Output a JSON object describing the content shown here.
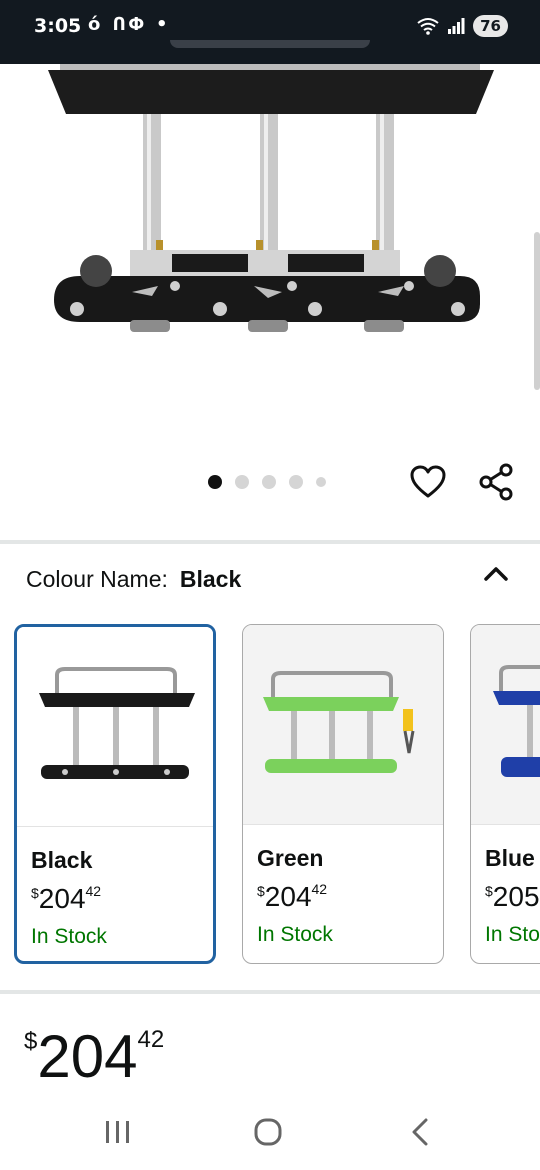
{
  "status_bar": {
    "time": "3:05",
    "left_icons": "ό ՈՓ •",
    "battery": "76"
  },
  "carousel": {
    "total_images": 5,
    "active_index": 0
  },
  "colour": {
    "label": "Colour Name:",
    "value": "Black"
  },
  "swatches": [
    {
      "name": "Black",
      "price_symbol": "$",
      "price_whole": "204",
      "price_fraction": "42",
      "stock": "In Stock",
      "selected": true,
      "color": "#1a1a1a"
    },
    {
      "name": "Green",
      "price_symbol": "$",
      "price_whole": "204",
      "price_fraction": "42",
      "stock": "In Stock",
      "selected": false,
      "color": "#7bd15c"
    },
    {
      "name": "Blue",
      "price_symbol": "$",
      "price_whole": "205",
      "price_fraction": "",
      "stock": "In Stock",
      "selected": false,
      "color": "#1f3fa8"
    }
  ],
  "price": {
    "symbol": "$",
    "whole": "204",
    "fraction": "42"
  },
  "colors": {
    "selected_border": "#2162a1",
    "in_stock": "#007600",
    "status_bar_bg": "#121920"
  }
}
